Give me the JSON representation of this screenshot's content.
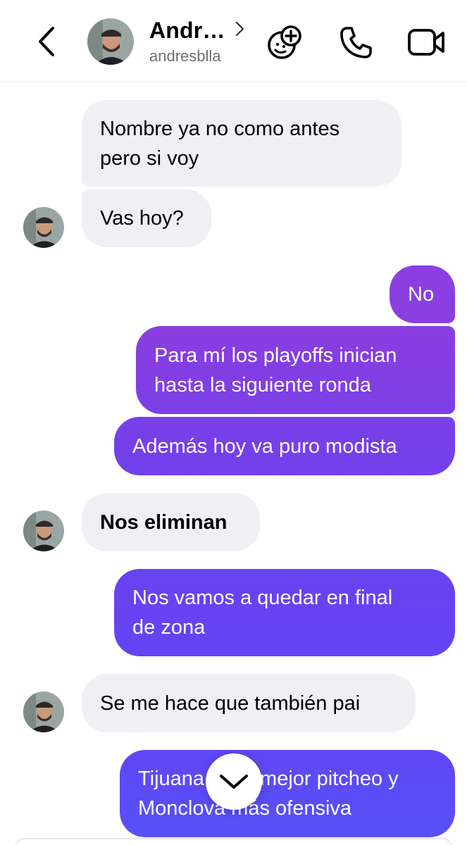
{
  "header": {
    "contact_name": "Andr…",
    "username": "andresblla",
    "icons": [
      "back-chevron",
      "contact-avatar",
      "chevron-right",
      "sticker-add",
      "phone",
      "video-camera"
    ]
  },
  "messages": [
    {
      "side": "incoming",
      "text_lines": [
        "Nombre ya no como antes",
        "pero si voy"
      ]
    },
    {
      "side": "incoming",
      "text_lines": [
        "Vas hoy?"
      ]
    },
    {
      "side": "outgoing",
      "text_lines": [
        "No"
      ]
    },
    {
      "side": "outgoing",
      "text_lines": [
        "Para mí los playoffs inician",
        "hasta la siguiente ronda"
      ]
    },
    {
      "side": "outgoing",
      "text_lines": [
        "Además hoy va puro modista"
      ]
    },
    {
      "side": "incoming",
      "text_lines": [
        "Nos eliminan"
      ],
      "bold": true
    },
    {
      "side": "outgoing",
      "text_lines": [
        "Nos vamos a quedar en final",
        "de zona"
      ]
    },
    {
      "side": "incoming",
      "text_lines": [
        "Se me hace que también pai"
      ]
    },
    {
      "side": "outgoing",
      "text_lines": [
        "Tijuana tiene mejor pitcheo y",
        "Monclova más ofensiva"
      ]
    }
  ],
  "scroll_down_icon": "chevron-down",
  "colors": {
    "incoming_bubble": "#efeff4",
    "outgoing_purple": "#8b3fe0",
    "outgoing_indigo": "#5f47f5",
    "outgoing_blue": "#5a4ff6",
    "secondary_text": "#6e6e73"
  }
}
